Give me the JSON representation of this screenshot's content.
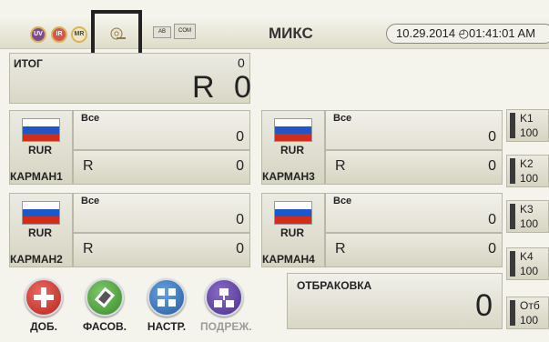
{
  "topbar": {
    "modes": [
      "UV",
      "IR",
      "MR"
    ],
    "ab_label": "AB",
    "com_label": "COM",
    "title": "МИКС",
    "datetime": "10.29.2014 ◴01:41:01 AM"
  },
  "total": {
    "label": "ИТОГ",
    "count": "0",
    "currency_symbol": "R",
    "amount": "0"
  },
  "pockets": [
    {
      "name": "КАРМАН1",
      "currency": "RUR",
      "filter": "Все",
      "count": "0",
      "symbol": "R",
      "amount": "0"
    },
    {
      "name": "КАРМАН2",
      "currency": "RUR",
      "filter": "Все",
      "count": "0",
      "symbol": "R",
      "amount": "0"
    },
    {
      "name": "КАРМАН3",
      "currency": "RUR",
      "filter": "Все",
      "count": "0",
      "symbol": "R",
      "amount": "0"
    },
    {
      "name": "КАРМАН4",
      "currency": "RUR",
      "filter": "Все",
      "count": "0",
      "symbol": "R",
      "amount": "0"
    }
  ],
  "side_counters": [
    {
      "label": "K1",
      "value": "100"
    },
    {
      "label": "K2",
      "value": "100"
    },
    {
      "label": "K3",
      "value": "100"
    },
    {
      "label": "K4",
      "value": "100"
    },
    {
      "label": "Отб",
      "value": "100"
    }
  ],
  "reject": {
    "label": "ОТБРАКОВКА",
    "value": "0"
  },
  "actions": [
    {
      "label": "ДОБ.",
      "icon": "plus-icon",
      "color": "#c9302c",
      "enabled": true
    },
    {
      "label": "ФАСОВ.",
      "icon": "bundle-icon",
      "color": "#4a9a3a",
      "enabled": true
    },
    {
      "label": "НАСТР.",
      "icon": "settings-icon",
      "color": "#2f6fb5",
      "enabled": true
    },
    {
      "label": "ПОДРЕЖ.",
      "icon": "mode-icon",
      "color": "#5a3d9b",
      "enabled": false
    }
  ]
}
